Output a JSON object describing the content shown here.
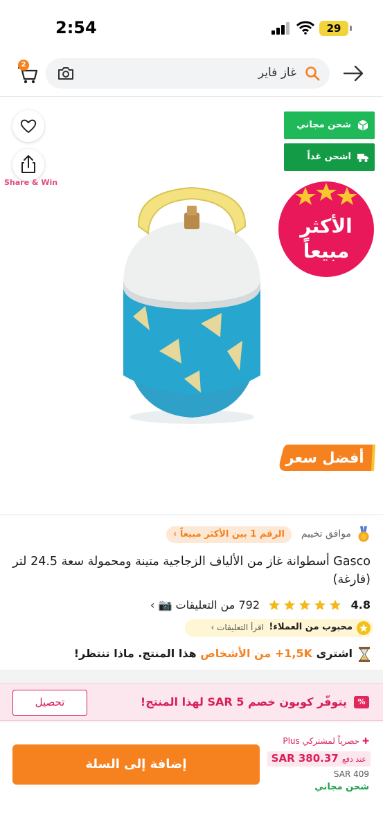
{
  "status_bar": {
    "time": "2:54",
    "battery": "29",
    "icons": [
      "signal-icon",
      "wifi-icon",
      "battery-icon"
    ]
  },
  "header": {
    "cart_count": "2",
    "search_query": "غاز فاير",
    "icons": [
      "cart-icon",
      "camera-icon",
      "search-icon",
      "back-arrow-icon"
    ]
  },
  "media": {
    "share_label": "Share & Win",
    "tags": [
      {
        "label": "شحن مجاني",
        "icon": "box-icon"
      },
      {
        "label": "اشحن غداً",
        "icon": "truck-icon"
      }
    ],
    "best_seller_badge": [
      "الأكثر",
      "مبيعاً"
    ],
    "best_price_label": "أفضل سعر",
    "icons": [
      "heart-icon",
      "share-icon"
    ]
  },
  "product": {
    "brand_note": "موافق تخييم",
    "rank_pill": "الرقم 1 بين الأكثر مبيعاً ›",
    "title": "Gasco أسطوانة غاز من الألياف الزجاجية متينة ومحمولة سعة 24.5 لتر (فارغة)",
    "rating": "4.8",
    "rating_value": 4.8,
    "reviews": "792 من التعليقات 📷 ›",
    "loved_text": "محبوب من العملاء!",
    "loved_link": "اقرأ التعليقات ›",
    "buyers_prefix": "اشترى",
    "buyers_highlight": "1,5K+ من الأشخاص",
    "buyers_suffix": "هذا المنتج. ماذا تنتظر!"
  },
  "coupon": {
    "icon_label": "%",
    "text": "يتوفّر كوبون خصم 5 SAR لهذا المنتج!",
    "button": "تحصيل"
  },
  "bottom": {
    "plus_line": "حصرياً لمشتركي Plus",
    "pay_label": "عند دفع",
    "pay_price": "SAR 380.37",
    "old_price": "SAR 409",
    "free_shipping": "شحن مجاني",
    "add_to_cart": "إضافة إلى السلة"
  },
  "colors": {
    "accent": "#f5821f",
    "pink": "#d81e56",
    "green": "#1fb95a"
  }
}
